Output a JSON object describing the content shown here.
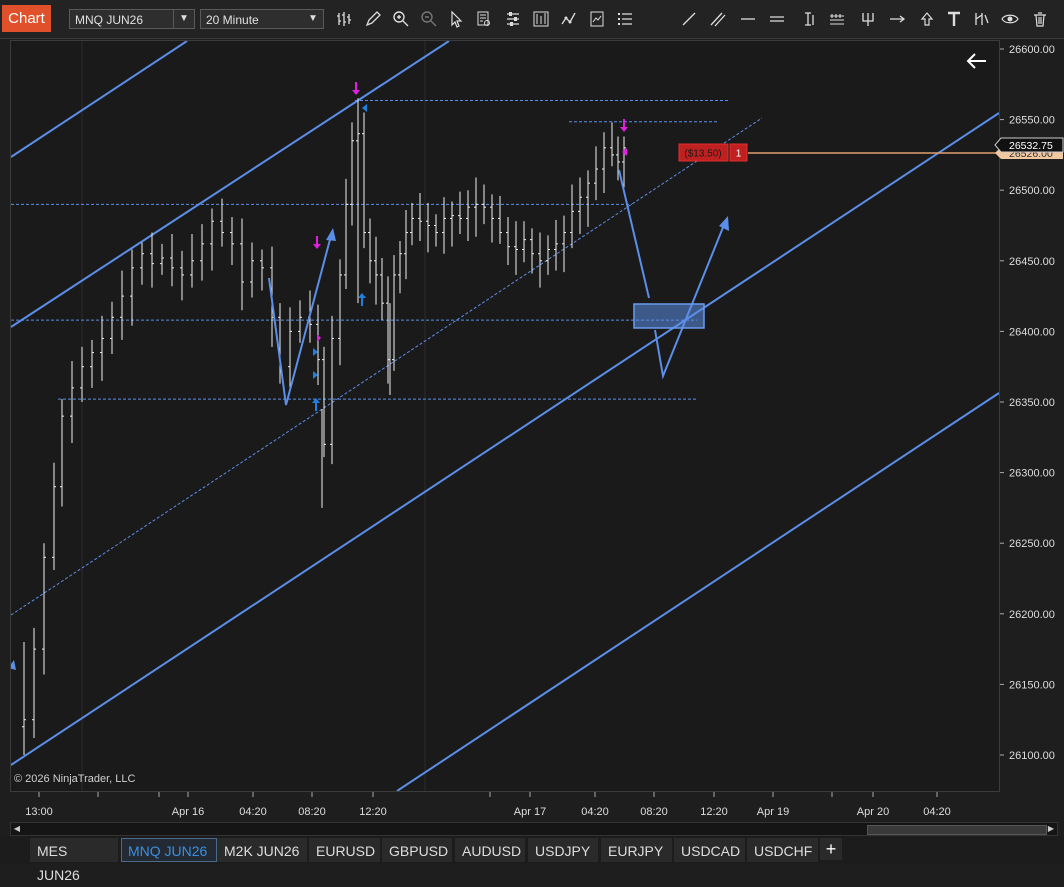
{
  "toolbar": {
    "chart_label": "Chart",
    "instrument": "MNQ JUN26",
    "interval": "20 Minute",
    "icons": [
      "bar-type-icon",
      "pencil-icon",
      "zoom-in-icon",
      "zoom-out-icon",
      "pointer-icon",
      "data-box-icon",
      "properties-icon",
      "strategies-icon",
      "indicators-icon",
      "templates-icon",
      "drawing-list-icon"
    ],
    "drawing_icons": [
      "line-icon",
      "ray-icon",
      "horizontal-line-icon",
      "vertical-line-icon",
      "ruler-icon",
      "fibonacci-icon",
      "andrews-pitchfork-icon",
      "arrow-line-icon",
      "arrow-up-icon",
      "text-icon",
      "region-icon",
      "eye-icon",
      "trash-icon"
    ]
  },
  "chart": {
    "copyright": "© 2026 NinjaTrader, LLC",
    "last_price": "26532.75",
    "position_line_price": "26526.00",
    "position_pnl": "($13.50)",
    "position_qty": "1",
    "colors": {
      "channel": "#5b8ee8",
      "hline": "#5b8ee8",
      "marker_sell": "#e020e0",
      "marker_buy": "#2080e0",
      "position_line": "#e0a070",
      "pnl_bg": "#c02020"
    }
  },
  "chart_data": {
    "type": "candlestick",
    "y_axis_labels": [
      "26600.00",
      "26550.00",
      "26500.00",
      "26450.00",
      "26400.00",
      "26350.00",
      "26300.00",
      "26250.00",
      "26200.00",
      "26150.00",
      "26100.00"
    ],
    "y_axis_values": [
      26600,
      26550,
      26500,
      26450,
      26400,
      26350,
      26300,
      26250,
      26200,
      26150,
      26100
    ],
    "x_axis_labels": [
      "13:00",
      "Apr 16",
      "04:20",
      "08:20",
      "12:20",
      "Apr 17",
      "04:20",
      "08:20",
      "12:20",
      "Apr 19",
      "Apr 20",
      "04:20"
    ],
    "ylim": [
      26075,
      26625
    ],
    "horizontal_lines": [
      26563.5,
      26548.5,
      26490,
      26408,
      26352
    ]
  },
  "tabs": [
    "MES JUN26",
    "MNQ JUN26",
    "M2K JUN26",
    "EURUSD",
    "GBPUSD",
    "AUDUSD",
    "USDJPY",
    "EURJPY",
    "USDCAD",
    "USDCHF"
  ],
  "active_tab": "MNQ JUN26",
  "add_tab_label": "+"
}
